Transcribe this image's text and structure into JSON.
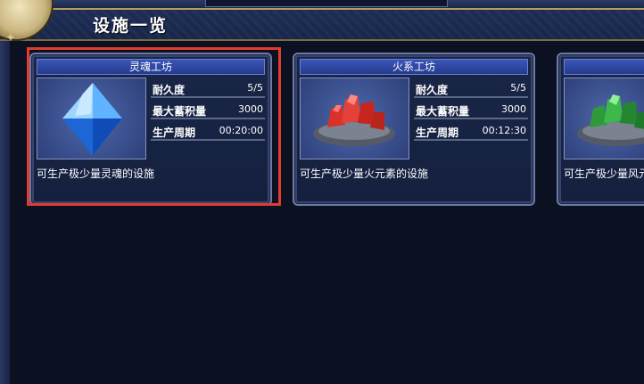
{
  "page": {
    "title": "设施一览"
  },
  "facilities": [
    {
      "name": "灵魂工坊",
      "image": "blue-crystal",
      "stats": [
        {
          "label": "耐久度",
          "value": "5/5"
        },
        {
          "label": "最大蓄积量",
          "value": "3000"
        },
        {
          "label": "生产周期",
          "value": "00:20:00"
        }
      ],
      "description": "可生产极少量灵魂的设施",
      "selected": true
    },
    {
      "name": "火系工坊",
      "image": "red-crystal-cluster",
      "stats": [
        {
          "label": "耐久度",
          "value": "5/5"
        },
        {
          "label": "最大蓄积量",
          "value": "3000"
        },
        {
          "label": "生产周期",
          "value": "00:12:30"
        }
      ],
      "description": "可生产极少量火元素的设施",
      "selected": false
    },
    {
      "name": "",
      "image": "green-crystal-cluster",
      "stats": [],
      "description": "可生产极少量风元",
      "selected": false
    }
  ],
  "colors": {
    "highlight": "#e33b2e",
    "title_bar": "#2f49a6",
    "background": "#0b1120"
  }
}
